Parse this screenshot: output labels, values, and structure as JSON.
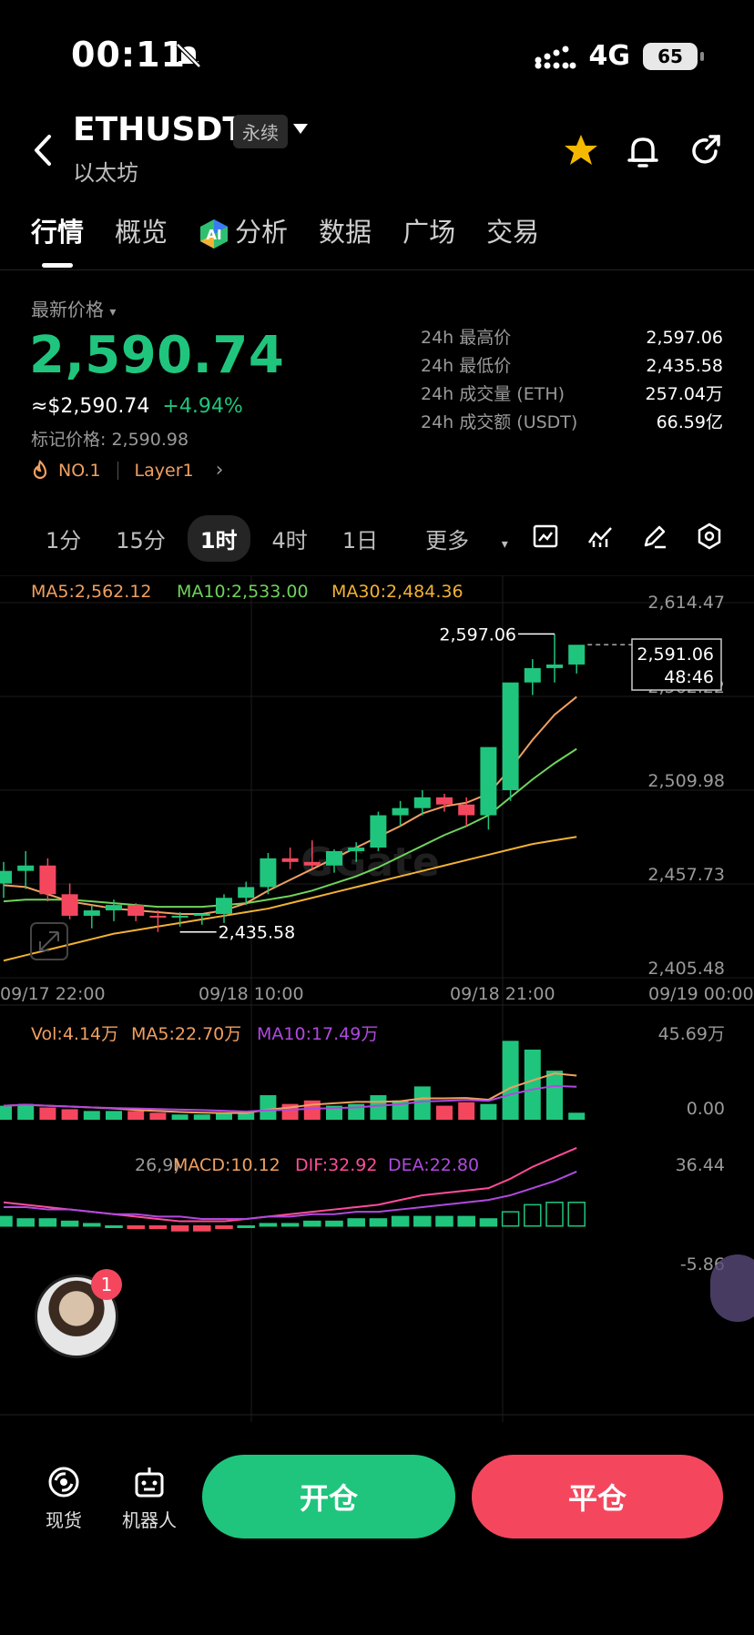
{
  "status": {
    "time": "00:11",
    "network": "4G",
    "battery": "65"
  },
  "header": {
    "symbol": "ETHUSDT",
    "badge": "永续",
    "subtitle": "以太坊"
  },
  "tabs": [
    "行情",
    "概览",
    "分析",
    "数据",
    "广场",
    "交易"
  ],
  "price": {
    "label": "最新价格",
    "last": "2,590.74",
    "usd": "≈$2,590.74",
    "change": "+4.94%",
    "mark": "标记价格: 2,590.98",
    "tag1": "NO.1",
    "tag2": "Layer1"
  },
  "stats": [
    {
      "k": "24h 最高价",
      "v": "2,597.06"
    },
    {
      "k": "24h 最低价",
      "v": "2,435.58"
    },
    {
      "k": "24h 成交量 (ETH)",
      "v": "257.04万"
    },
    {
      "k": "24h 成交额 (USDT)",
      "v": "66.59亿"
    }
  ],
  "intervals": [
    "1分",
    "15分",
    "1时",
    "4时",
    "1日",
    "更多"
  ],
  "chart_data": {
    "type": "candlestick",
    "ma_labels": [
      "MA5:2,562.12",
      "MA10:2,533.00",
      "MA30:2,484.36"
    ],
    "y_ticks": [
      "2,614.47",
      "2,562.22",
      "2,509.98",
      "2,457.73",
      "2,405.48"
    ],
    "x_ticks": [
      "09/17 22:00",
      "09/18 10:00",
      "09/18 21:00",
      "09/19 00:00"
    ],
    "high_label": "2,597.06",
    "low_label": "2,435.58",
    "current_price": "2,591.06",
    "countdown": "48:46",
    "ylim": [
      2405.48,
      2614.47
    ],
    "candles": [
      [
        2458,
        2470,
        2450,
        2465
      ],
      [
        2465,
        2476,
        2455,
        2468
      ],
      [
        2468,
        2472,
        2448,
        2452
      ],
      [
        2452,
        2458,
        2438,
        2440
      ],
      [
        2440,
        2446,
        2433,
        2443
      ],
      [
        2443,
        2449,
        2437,
        2446
      ],
      [
        2446,
        2447,
        2437,
        2440
      ],
      [
        2440,
        2443,
        2431,
        2439
      ],
      [
        2439,
        2442,
        2434,
        2440
      ],
      [
        2440,
        2441,
        2435,
        2441
      ],
      [
        2441,
        2452,
        2436,
        2450
      ],
      [
        2450,
        2459,
        2446,
        2456
      ],
      [
        2456,
        2475,
        2452,
        2472
      ],
      [
        2472,
        2478,
        2466,
        2470
      ],
      [
        2470,
        2482,
        2466,
        2468
      ],
      [
        2468,
        2477,
        2464,
        2476
      ],
      [
        2476,
        2481,
        2470,
        2478
      ],
      [
        2478,
        2498,
        2476,
        2496
      ],
      [
        2496,
        2504,
        2490,
        2500
      ],
      [
        2500,
        2510,
        2496,
        2506
      ],
      [
        2506,
        2508,
        2498,
        2502
      ],
      [
        2502,
        2506,
        2490,
        2496
      ],
      [
        2496,
        2502,
        2488,
        2534
      ],
      [
        2510,
        2566,
        2504,
        2570
      ],
      [
        2570,
        2583,
        2563,
        2578
      ],
      [
        2578,
        2597,
        2570,
        2580
      ],
      [
        2580,
        2590,
        2575,
        2591
      ]
    ],
    "ma5": [
      2457,
      2456,
      2452,
      2448,
      2446,
      2444,
      2443,
      2442,
      2441,
      2441,
      2443,
      2447,
      2454,
      2460,
      2466,
      2472,
      2478,
      2484,
      2490,
      2497,
      2501,
      2503,
      2508,
      2522,
      2538,
      2552,
      2562
    ],
    "ma10": [
      2448,
      2449,
      2449,
      2449,
      2448,
      2447,
      2446,
      2445,
      2445,
      2445,
      2446,
      2447,
      2449,
      2451,
      2454,
      2458,
      2462,
      2467,
      2473,
      2479,
      2485,
      2490,
      2496,
      2506,
      2516,
      2525,
      2533
    ],
    "ma30": [
      2415,
      2418,
      2421,
      2424,
      2427,
      2430,
      2432,
      2434,
      2436,
      2438,
      2440,
      2442,
      2444,
      2447,
      2450,
      2453,
      2456,
      2459,
      2462,
      2465,
      2468,
      2471,
      2474,
      2477,
      2480,
      2482,
      2484
    ],
    "volume": {
      "labels": [
        "Vol:4.14万",
        "MA5:22.70万",
        "MA10:17.49万"
      ],
      "y_ticks": [
        "45.69万",
        "0.00"
      ],
      "values": [
        8,
        9,
        7,
        6,
        5,
        5,
        5,
        4,
        3,
        3,
        4,
        5,
        14,
        9,
        11,
        8,
        9,
        14,
        11,
        19,
        8,
        10,
        9,
        45,
        40,
        28,
        4
      ]
    },
    "macd": {
      "labels": [
        "MACD:10.12",
        "DIF:32.92",
        "DEA:22.80"
      ],
      "y_ticks": [
        "36.44",
        "-5.86"
      ],
      "hist": [
        4,
        3,
        3,
        2,
        1,
        0,
        -1,
        -1,
        -2,
        -2,
        -1,
        0,
        1,
        1,
        2,
        2,
        3,
        3,
        4,
        4,
        4,
        4,
        3,
        6,
        9,
        10,
        10
      ],
      "dif": [
        10,
        9,
        8,
        7,
        6,
        5,
        4,
        3,
        2,
        2,
        2,
        3,
        4,
        5,
        6,
        7,
        8,
        9,
        11,
        13,
        14,
        15,
        16,
        20,
        25,
        29,
        33
      ],
      "dea": [
        8,
        8,
        7,
        7,
        6,
        5,
        5,
        4,
        4,
        3,
        3,
        3,
        4,
        4,
        5,
        5,
        6,
        6,
        7,
        8,
        9,
        10,
        11,
        13,
        16,
        19,
        23
      ]
    }
  },
  "bottom": {
    "spot": "现货",
    "robot": "机器人",
    "open": "开仓",
    "close": "平仓",
    "badge": "1"
  },
  "colors": {
    "up": "#20c57d",
    "down": "#f4475e",
    "ma5": "#f0a060",
    "ma10": "#6fd35c",
    "ma30": "#f2b233",
    "vma10": "#b04adf",
    "dif": "#ff4d9a",
    "dea": "#b04adf"
  }
}
